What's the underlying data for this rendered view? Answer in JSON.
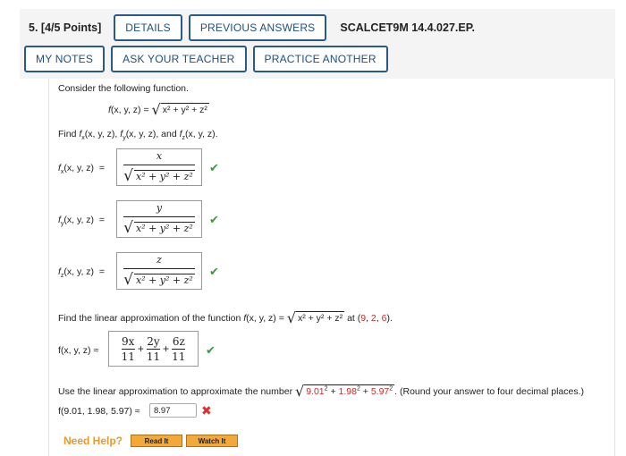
{
  "question": {
    "number_label": "5.",
    "points_label": "[4/5 Points]",
    "code": "SCALCET9M 14.4.027.EP."
  },
  "toolbar": {
    "details": "DETAILS",
    "previous_answers": "PREVIOUS ANSWERS",
    "my_notes": "MY NOTES",
    "ask_teacher": "ASK YOUR TEACHER",
    "practice_another": "PRACTICE ANOTHER"
  },
  "problem": {
    "intro": "Consider the following function.",
    "function_lhs": "f(x, y, z) =",
    "find_prefix": "Find",
    "fx_label": "f",
    "fy_label": "f",
    "fz_label": "f",
    "and_word": "and",
    "args": "(x, y, z)",
    "answers": {
      "fx_num": "x",
      "fy_num": "y",
      "fz_num": "z",
      "den_radicand": "x² + y² + z²"
    },
    "linear_prompt": "Find the linear approximation of the function",
    "linear_point_prefix": "at (",
    "point": [
      "9",
      "2",
      "6"
    ],
    "linear_lhs": "f(x, y, z) ≈",
    "linear_terms": [
      {
        "num": "9x",
        "den": "11"
      },
      {
        "num": "2y",
        "den": "11"
      },
      {
        "num": "6z",
        "den": "11"
      }
    ],
    "approx_prompt": "Use the linear approximation to approximate the number",
    "approx_values": [
      "9.01",
      "1.98",
      "5.97"
    ],
    "approx_note": ". (Round your answer to four decimal places.)",
    "approx_lhs": "f(9.01, 1.98, 5.97) ≈",
    "approx_input_value": "8.97"
  },
  "help": {
    "label": "Need Help?",
    "read_it": "Read It",
    "watch_it": "Watch It"
  },
  "colors": {
    "button_border": "#2a5a8a",
    "correct": "#3a9a3a",
    "incorrect": "#d83232",
    "highlight_red": "#cc2a2a",
    "help_orange": "#e69a2e"
  }
}
